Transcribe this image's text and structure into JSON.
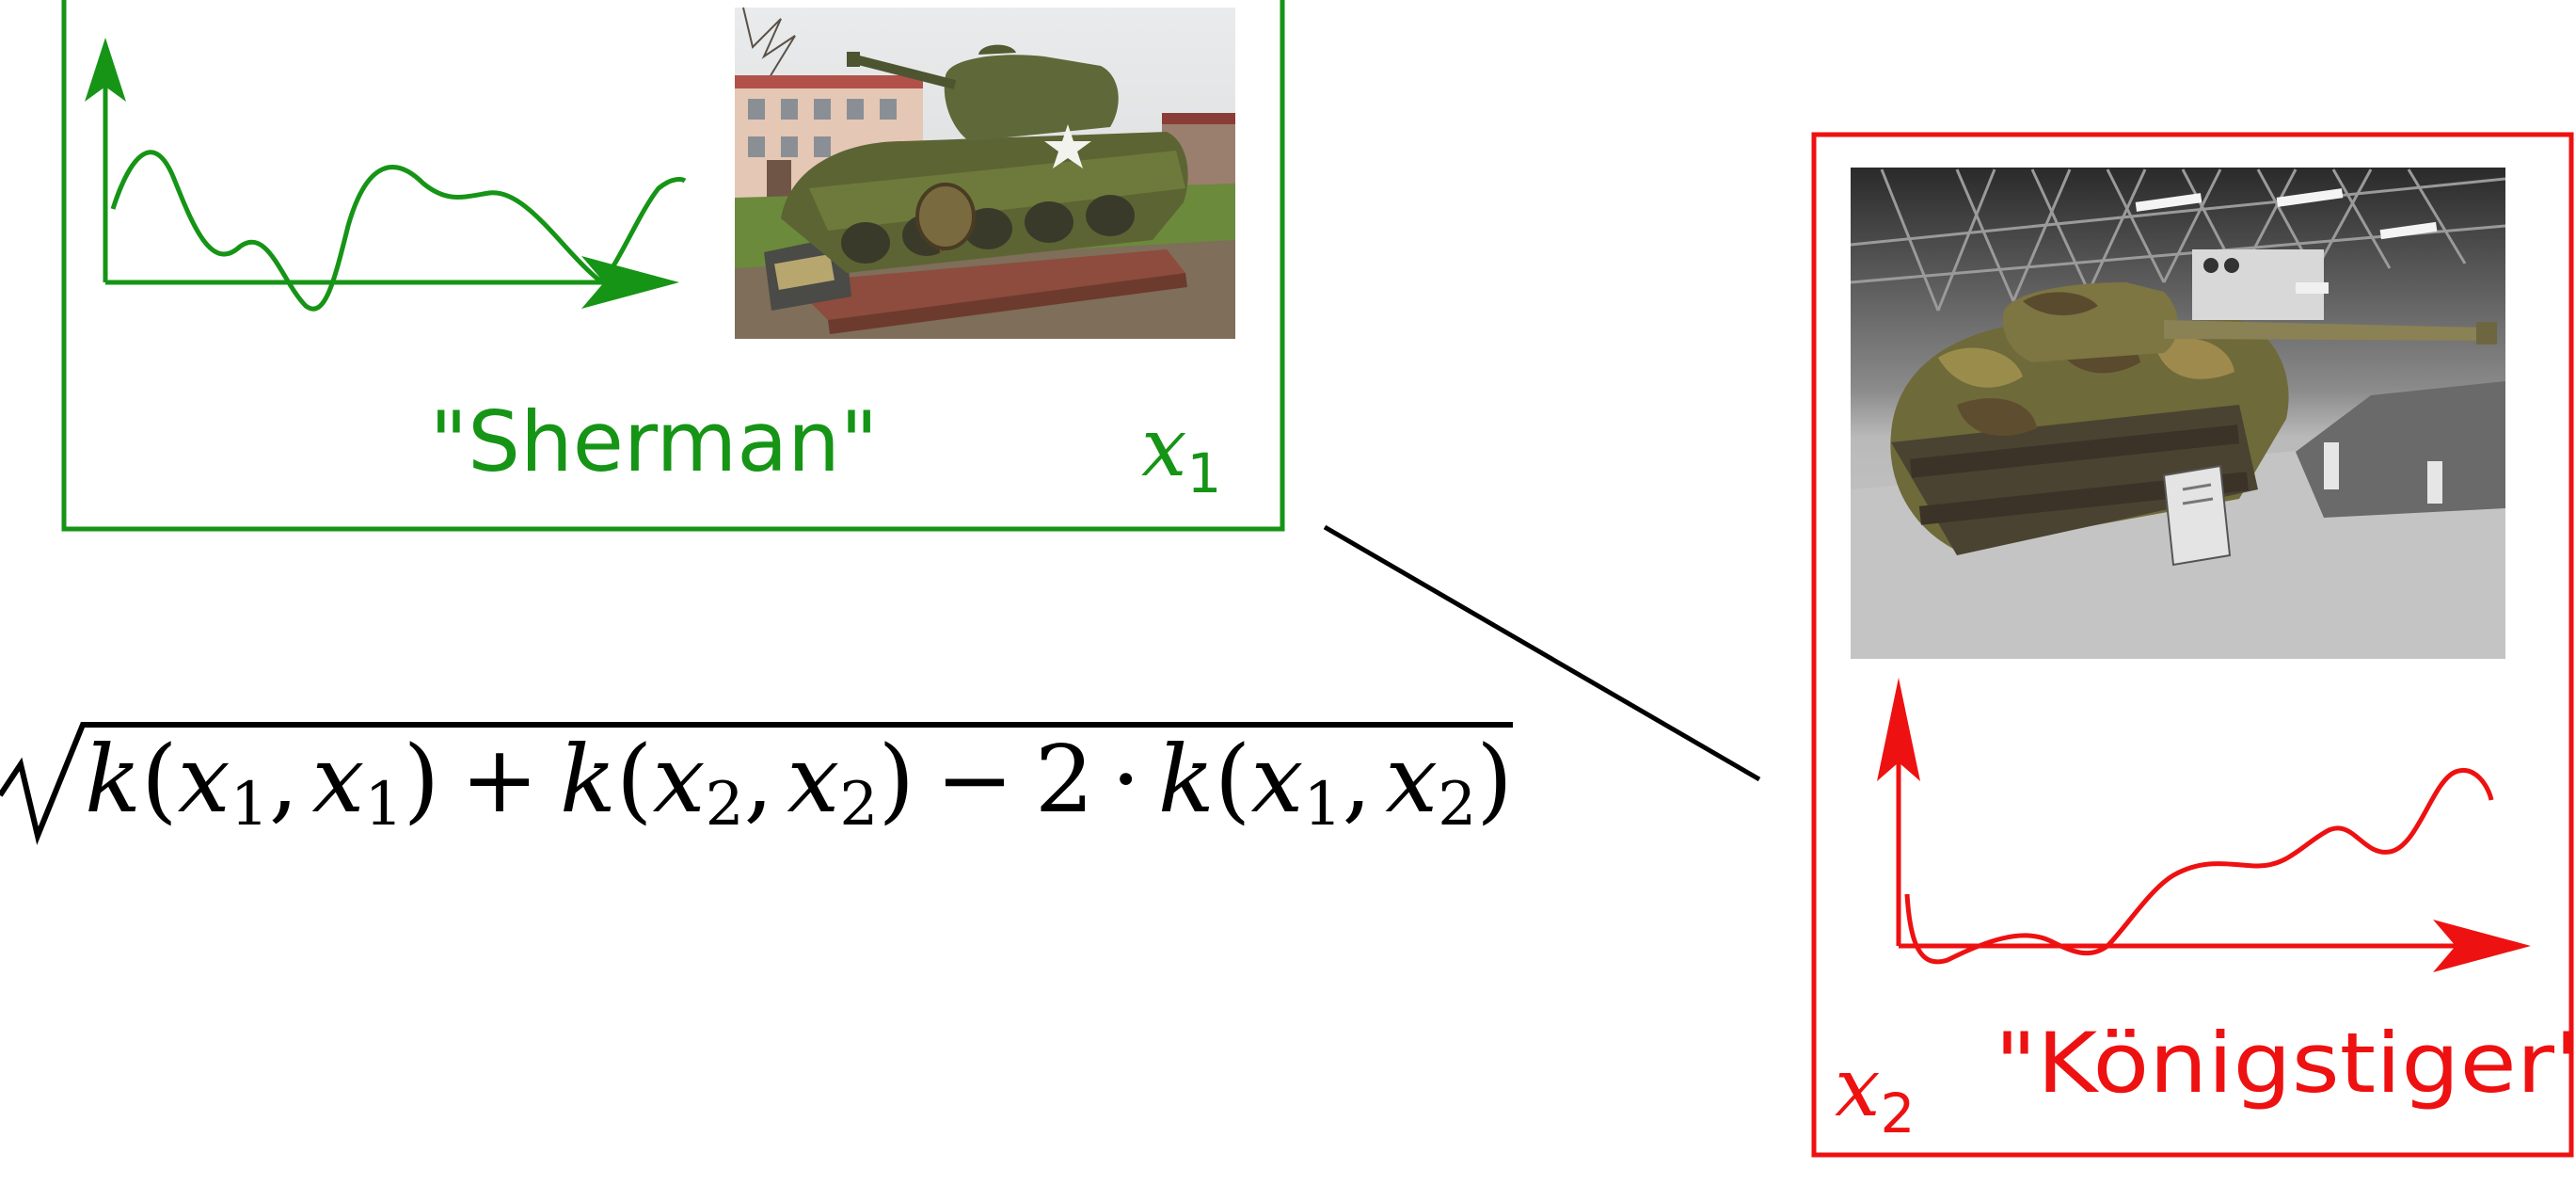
{
  "sample_1": {
    "color": "#169416",
    "label": "\"Sherman\"",
    "var": "x",
    "sub": "1",
    "photo": "sherman-tank-photo"
  },
  "sample_2": {
    "color": "#ee1111",
    "label": "\"Königstiger\"",
    "var": "x",
    "sub": "2",
    "photo": "koenigstiger-tank-photo"
  },
  "formula": {
    "text": "k(x1, x1) + k(x2, x2) − 2 · k(x1, x2)",
    "k": "k",
    "x": "x",
    "one": "1",
    "two": "2",
    "open": "(",
    "close": ")",
    "comma": ",",
    "plus": "+",
    "minus": "−",
    "cdot": "·"
  }
}
